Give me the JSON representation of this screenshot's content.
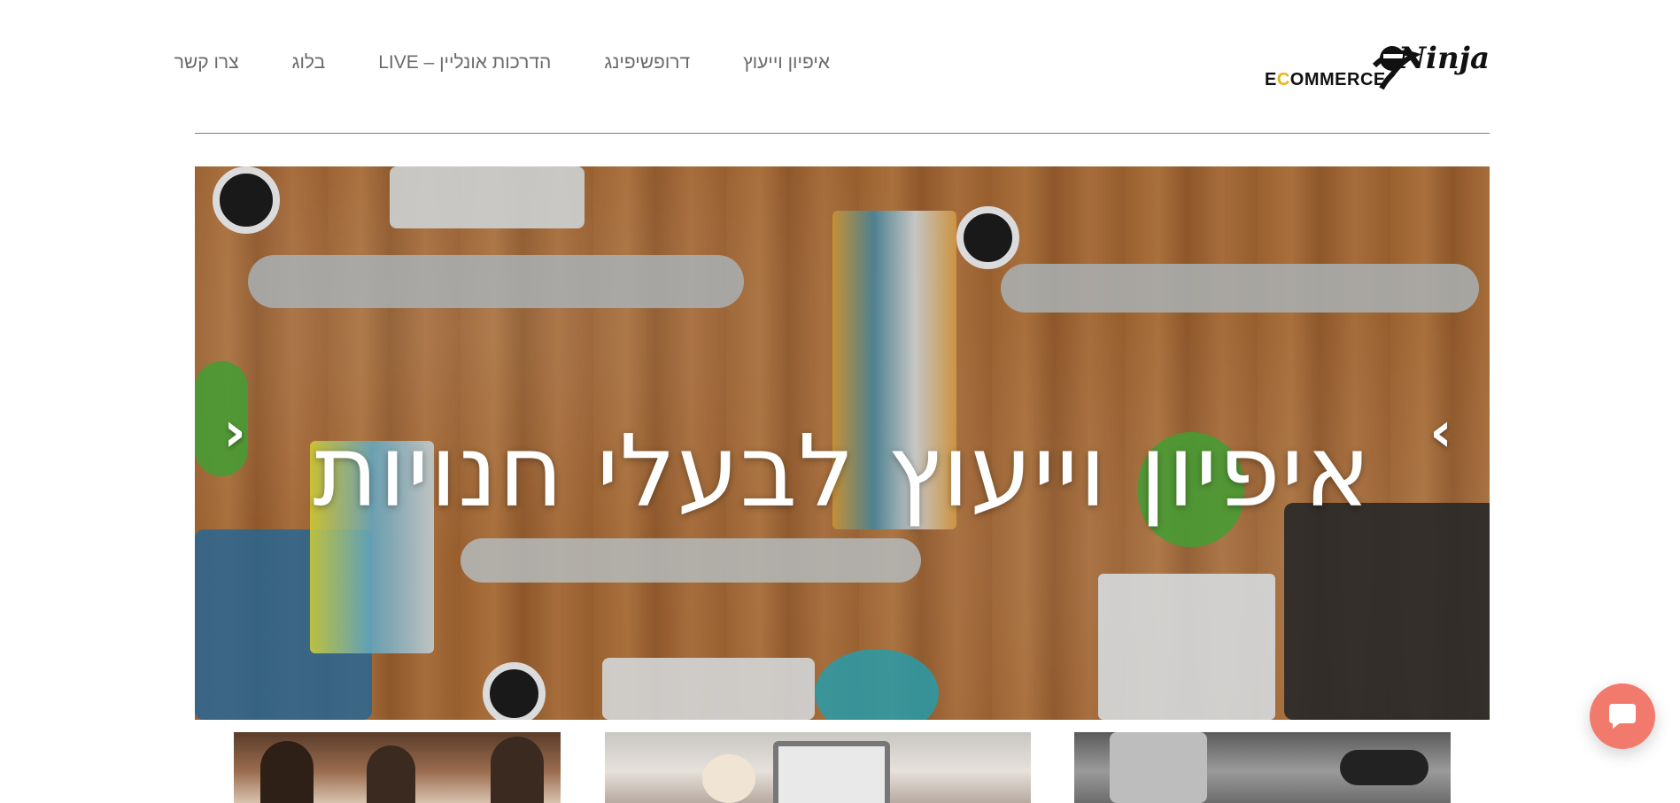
{
  "header": {
    "logo": {
      "wordmark_prefix": "E",
      "wordmark_o": "C",
      "wordmark_rest": "OMMERCE",
      "script": "Ninja"
    },
    "nav": [
      {
        "label": "איפיון וייעוץ"
      },
      {
        "label": "דרופשיפינג"
      },
      {
        "label": "הדרכות אונליין – LIVE"
      },
      {
        "label": "בלוג"
      },
      {
        "label": "צרו קשר"
      }
    ]
  },
  "hero": {
    "title": "איפיון וייעוץ לבעלי חנויות",
    "prev_symbol": "‹",
    "next_symbol": "›"
  },
  "chat": {
    "icon": "chat-bubble-icon",
    "color": "#f27a6c"
  },
  "colors": {
    "nav_text": "#6a6a6a",
    "accent_logo": "#e7b514"
  }
}
